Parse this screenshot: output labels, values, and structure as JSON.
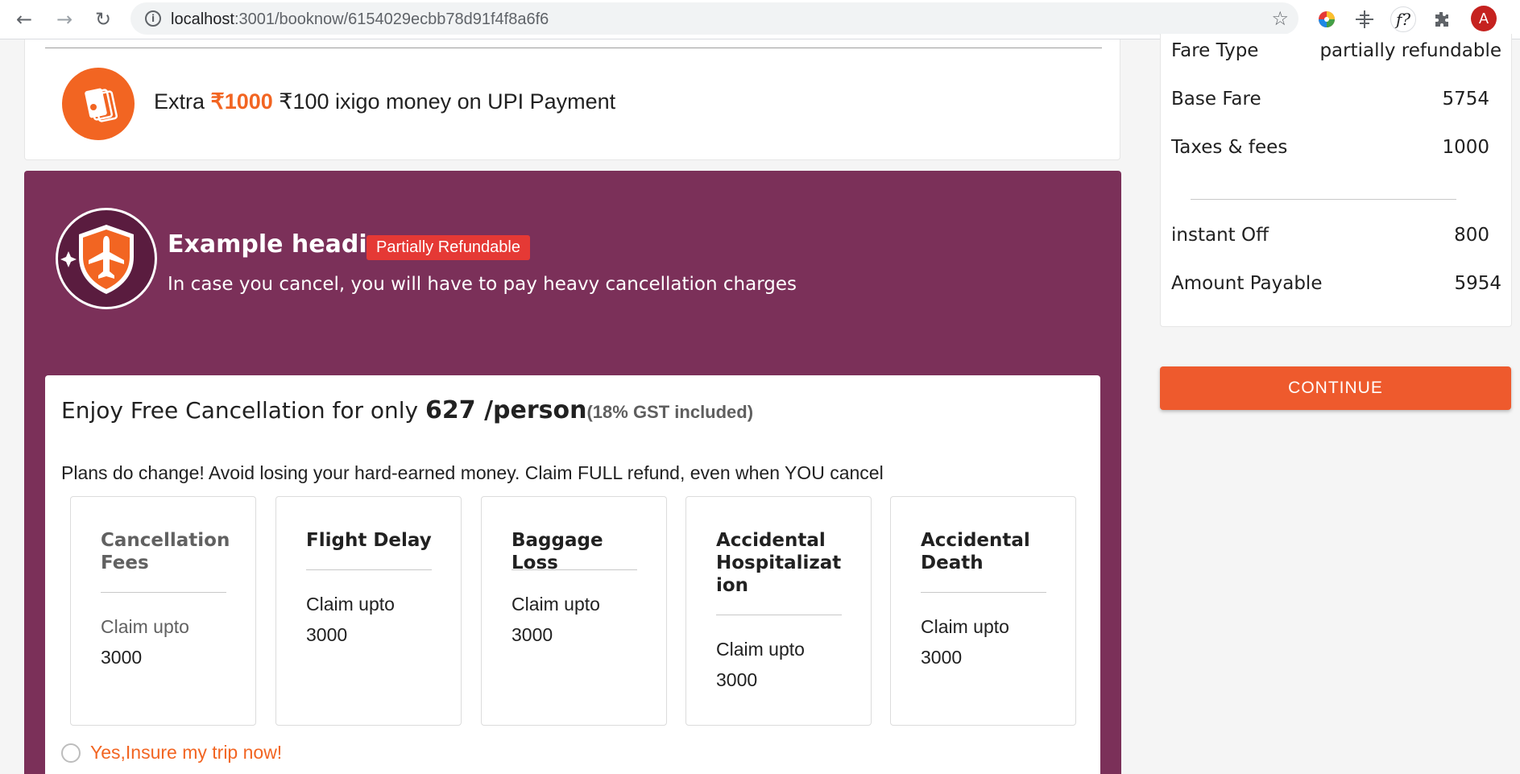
{
  "browser": {
    "url_host": "localhost",
    "url_path": ":3001/booknow/6154029ecbb78d91f4f8a6f6",
    "avatar_letter": "A",
    "icons": [
      "back-arrow-icon",
      "forward-arrow-icon",
      "reload-icon",
      "info-icon",
      "star-icon",
      "color-wheel-icon",
      "move-icon",
      "font-icon",
      "puzzle-icon"
    ]
  },
  "offer": {
    "prefix": "Extra ",
    "highlight": "₹1000",
    "suffix": " ₹100 ixigo money on UPI Payment",
    "icon": "wallet-icon"
  },
  "insurance": {
    "heading": "Example heading",
    "badge": "Partially Refundable",
    "subtext": "In case you cancel, you will have to pay heavy cancellation charges",
    "icon": "plane-shield-icon",
    "plan": {
      "title_prefix": "Enjoy Free Cancellation for only ",
      "price": "627 /person",
      "gst": "(18% GST included)",
      "description": "Plans do change! Avoid losing your hard-earned money. Claim FULL refund, even when YOU cancel",
      "benefits": [
        {
          "name": "Cancellation Fees",
          "claim_label": "Claim upto",
          "amount": "3000"
        },
        {
          "name": "Flight Delay",
          "claim_label": "Claim upto",
          "amount": "3000"
        },
        {
          "name": "Baggage Loss",
          "claim_label": "Claim upto",
          "amount": "3000"
        },
        {
          "name": "Accidental Hospitalization",
          "claim_label": "Claim upto",
          "amount": "3000"
        },
        {
          "name": "Accidental Death",
          "claim_label": "Claim upto",
          "amount": "3000"
        }
      ],
      "opt_in_label": "Yes,Insure my trip now!"
    }
  },
  "fare": {
    "rows": [
      {
        "label": "Fare Type",
        "value": "partially refundable"
      },
      {
        "label": "Base Fare",
        "value": "5754"
      },
      {
        "label": "Taxes & fees",
        "value": "1000"
      },
      {
        "label": "instant Off",
        "value": "800"
      },
      {
        "label": "Amount Payable",
        "value": "5954"
      }
    ],
    "continue_label": "CONTINUE"
  },
  "colors": {
    "accent": "#ee5a2d",
    "panel": "#7b3059",
    "badge": "#e53935"
  }
}
